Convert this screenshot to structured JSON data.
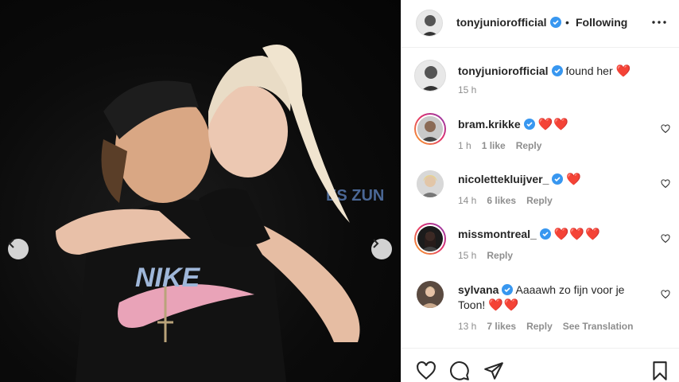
{
  "post": {
    "author": "tonyjuniorofficial",
    "follow_status": "Following",
    "separator": "•",
    "caption": "found her",
    "caption_emoji": "❤️",
    "caption_time": "15 h"
  },
  "comments": [
    {
      "user": "bram.krikke",
      "text": "",
      "emoji": "❤️❤️",
      "time": "1 h",
      "likes": "1 like",
      "reply": "Reply",
      "extra": "",
      "story_ring": true
    },
    {
      "user": "nicolettekluijver_",
      "text": "",
      "emoji": "❤️",
      "time": "14 h",
      "likes": "6 likes",
      "reply": "Reply",
      "extra": "",
      "story_ring": false
    },
    {
      "user": "missmontreal_",
      "text": "",
      "emoji": "❤️❤️❤️",
      "time": "15 h",
      "likes": "",
      "reply": "Reply",
      "extra": "",
      "story_ring": true
    },
    {
      "user": "sylvana",
      "text": "Aaaawh zo fijn voor je Toon!",
      "emoji": "❤️❤️",
      "time": "13 h",
      "likes": "7 likes",
      "reply": "Reply",
      "extra": "See Translation",
      "story_ring": false
    }
  ],
  "icons": {
    "more": "more-horizontal-icon",
    "verified": "verified-badge-icon",
    "like": "heart-outline-icon",
    "comment": "comment-bubble-icon",
    "share": "paper-plane-icon",
    "save": "bookmark-icon",
    "prev": "chevron-left-icon",
    "next": "chevron-right-icon"
  },
  "colors": {
    "verified": "#3897f0",
    "heart": "#e0102a",
    "meta": "#8e8e8e",
    "text": "#262626"
  }
}
